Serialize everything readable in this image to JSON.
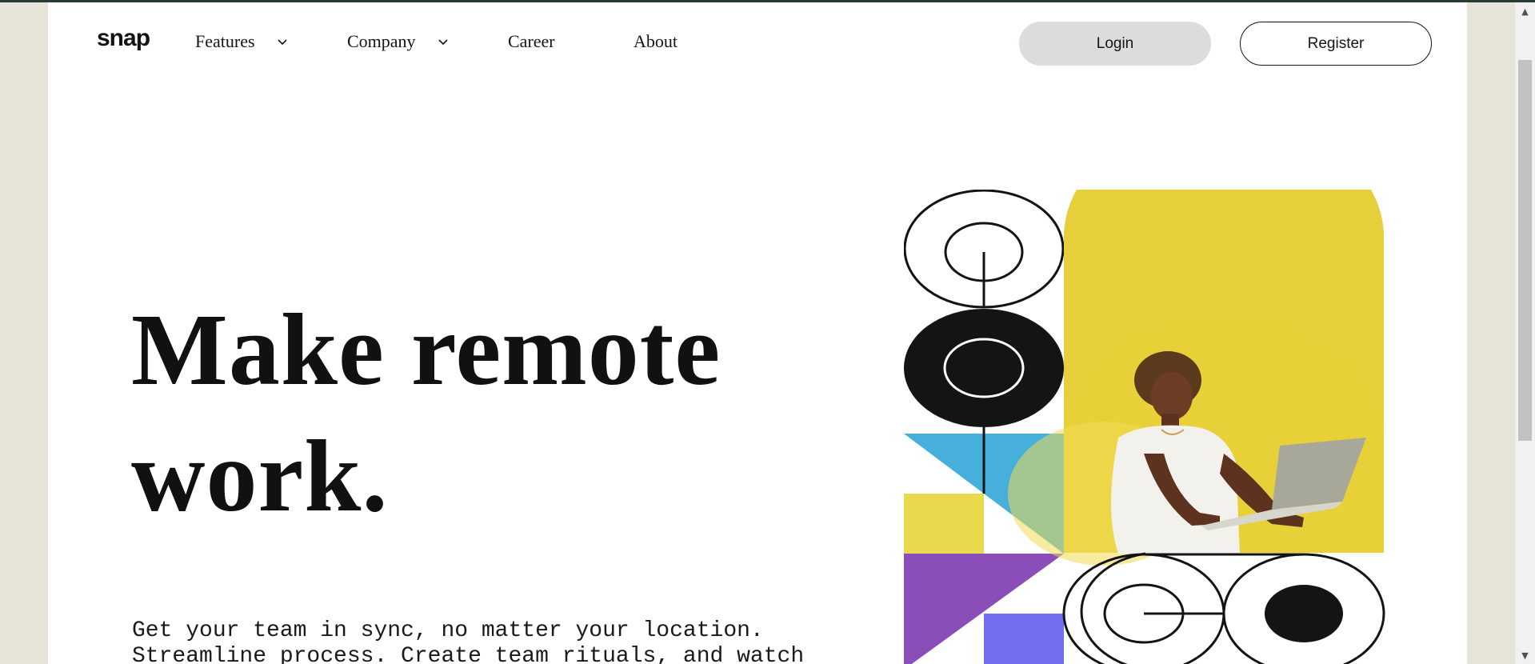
{
  "nav": {
    "logo": "snap",
    "items": [
      {
        "label": "Features",
        "has_dropdown": true,
        "dropdown_icon": "chevron-down-icon"
      },
      {
        "label": "Company",
        "has_dropdown": true,
        "dropdown_icon": "chevron-down-icon"
      },
      {
        "label": "Career",
        "has_dropdown": false
      },
      {
        "label": "About",
        "has_dropdown": false
      }
    ],
    "login_label": "Login",
    "register_label": "Register"
  },
  "hero": {
    "title": "Make remote work.",
    "subtitle": "Get your team in sync, no matter your location. Streamline process. Create team rituals, and watch"
  },
  "colors": {
    "background_outer": "#e6e3d9",
    "page_bg": "#ffffff",
    "text": "#141414",
    "login_bg": "#dedbdb",
    "accent_purple": "#726ef0",
    "accent_blue": "#47afdc",
    "accent_yellow": "#e8d94d",
    "accent_violet": "#8b4eb8"
  },
  "art": {
    "image_description_icon": "person-with-laptop-photo"
  }
}
